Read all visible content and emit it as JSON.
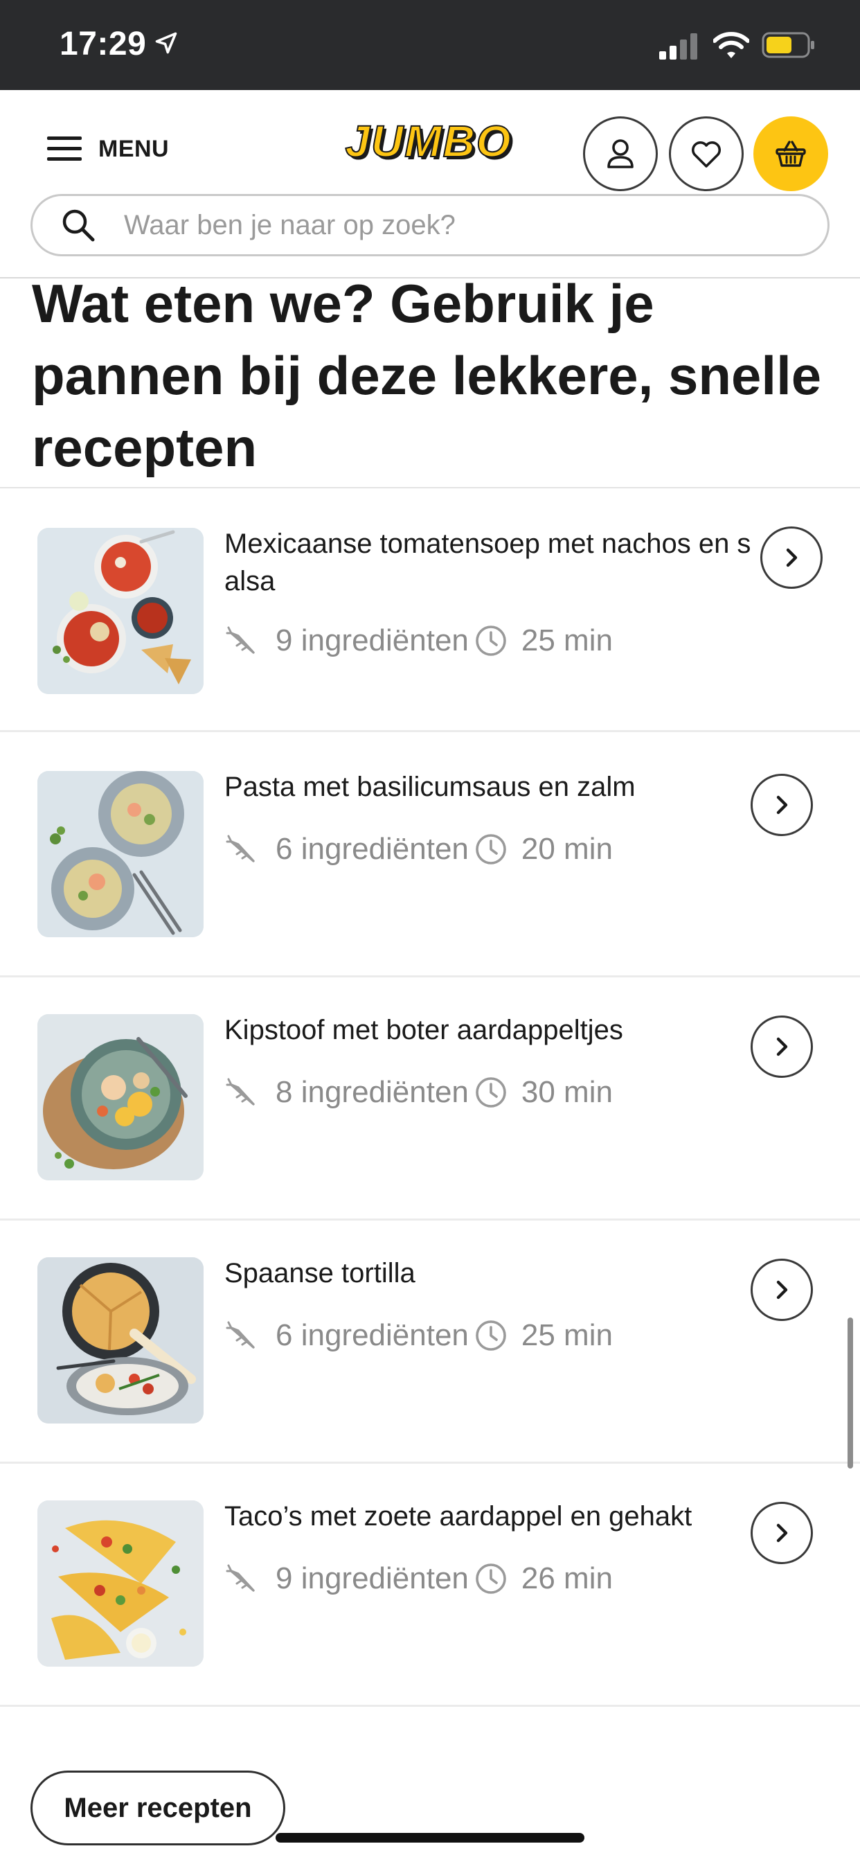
{
  "status_bar": {
    "time": "17:29"
  },
  "header": {
    "menu_label": "MENU",
    "logo_text": "JUMBO",
    "brand_color": "#fdc513",
    "icons": [
      "menu-icon",
      "account-icon",
      "heart-icon",
      "basket-icon"
    ]
  },
  "search": {
    "placeholder": "Waar ben je naar op zoek?",
    "value": ""
  },
  "page_title": {
    "part1_bold": "Wat eten we?",
    "part2": " Gebruik je pannen bij deze ",
    "part3_bold": "lekkere, snelle recepten"
  },
  "recipes": [
    {
      "name": "Mexicaanse tomatensoep met nachos en salsa",
      "ingredients": "9 ingrediënten",
      "time": "25 min"
    },
    {
      "name": "Pasta met basilicumsaus en zalm",
      "ingredients": "6 ingrediënten",
      "time": "20 min"
    },
    {
      "name": "Kipstoof met boter aardappeltjes",
      "ingredients": "8 ingrediënten",
      "time": "30 min"
    },
    {
      "name": "Spaanse tortilla",
      "ingredients": "6 ingrediënten",
      "time": "25 min"
    },
    {
      "name": "Taco’s met zoete aardappel en gehakt",
      "ingredients": "9 ingrediënten",
      "time": "26 min"
    }
  ],
  "more_button": "Meer recepten"
}
